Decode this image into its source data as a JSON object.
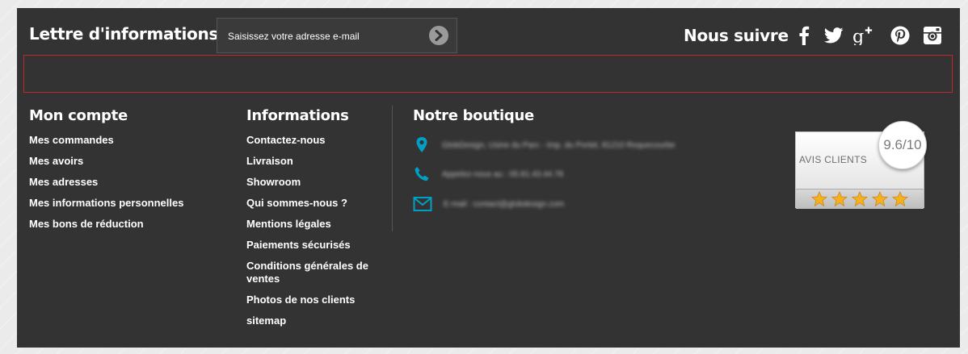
{
  "newsletter": {
    "title": "Lettre d'informations",
    "placeholder": "Saisissez votre adresse e-mail"
  },
  "follow": {
    "title": "Nous suivre",
    "icons": [
      "facebook-icon",
      "twitter-icon",
      "google-plus-icon",
      "pinterest-icon",
      "instagram-icon"
    ]
  },
  "account": {
    "title": "Mon compte",
    "links": [
      "Mes commandes",
      "Mes avoirs",
      "Mes adresses",
      "Mes informations personnelles",
      "Mes bons de réduction"
    ]
  },
  "info": {
    "title": "Informations",
    "links": [
      "Contactez-nous",
      "Livraison",
      "Showroom",
      "Qui sommes-nous ?",
      "Mentions légales",
      "Paiements sécurisés",
      "Conditions générales de ventes",
      "Photos de nos clients",
      "sitemap"
    ]
  },
  "store": {
    "title": "Notre boutique",
    "address": "GlobDesign, Usine du Parc - Imp. du Portet, 81210 Roquecourbe",
    "phone": "Appelez-nous au : 05.81.43.44.78",
    "email": "E-mail : contact@globdesign.com"
  },
  "reviews": {
    "label": "AVIS CLIENTS",
    "score": "9.6/10",
    "stars": 5
  },
  "colors": {
    "footer_bg": "#333333",
    "accent": "#00a0c6",
    "alert_border": "#c0282d"
  }
}
